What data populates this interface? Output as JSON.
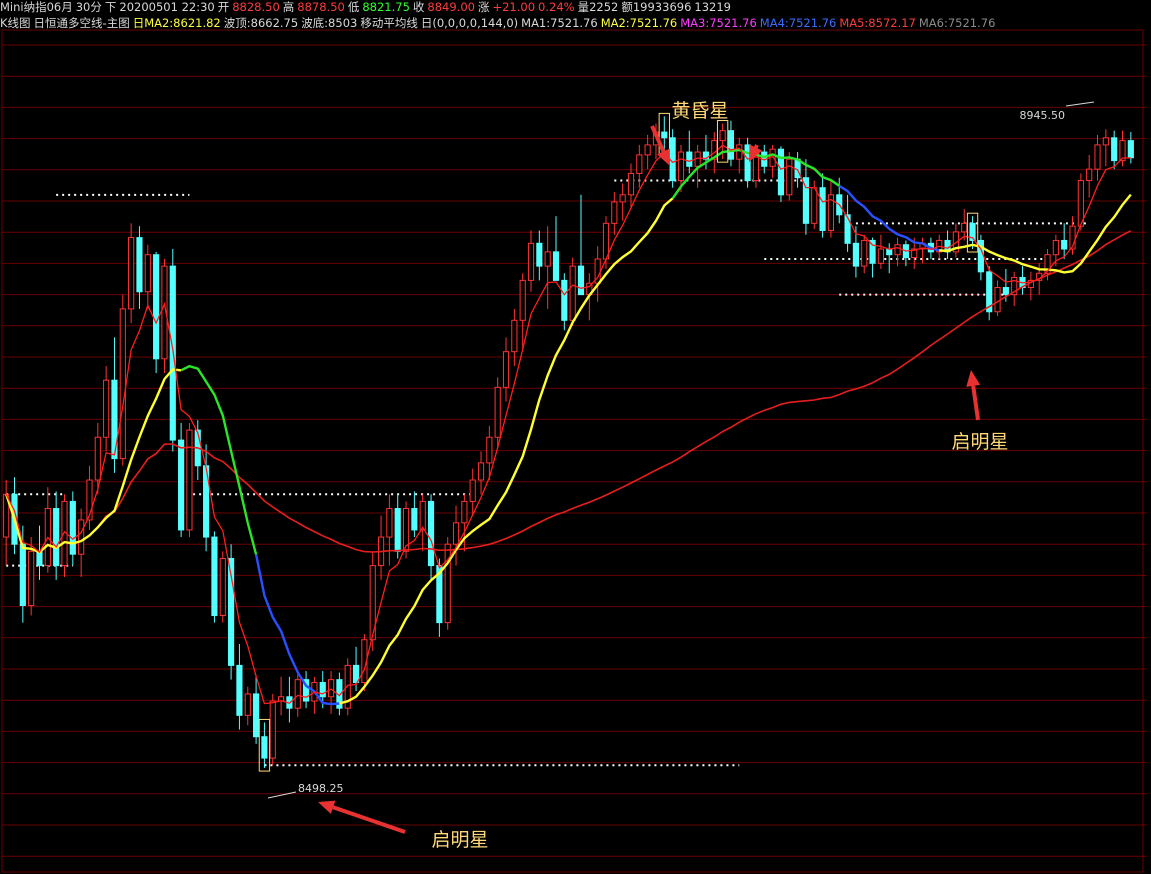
{
  "header": {
    "symbol": "Mini纳指06月",
    "period": "30分",
    "direction": "下",
    "datetime": "20200501 22:30",
    "open_label": "开",
    "open": "8828.50",
    "high_label": "高",
    "high": "8878.50",
    "low_label": "低",
    "low": "8821.75",
    "close_label": "收",
    "close": "8849.00",
    "change_label": "涨",
    "change": "+21.00",
    "change_pct": "0.24%",
    "volume": "量2252",
    "amount": "额19933696",
    "extra": "13219"
  },
  "indicator_bar": {
    "main_label": "K线图",
    "ind1": "日恒通多空线-主图",
    "ind1_ma2": "日MA2:8621.82",
    "ind1_top": "波顶:8662.75",
    "ind1_bottom": "波底:8503",
    "ind2": "移动平均线",
    "ind2_params": "日(0,0,0,0,144,0)",
    "ma1": "MA1:7521.76",
    "ma2": "MA2:7521.76",
    "ma3": "MA3:7521.76",
    "ma4": "MA4:7521.76",
    "ma5": "MA5:8572.17",
    "ma6": "MA6:7521.76"
  },
  "colors": {
    "background": "#000000",
    "grid": "#6a0000",
    "up_candle": "#ff3232",
    "down_candle": "#54ffff",
    "ma_short": "#ff1e1e",
    "ma_bull": "#ffff32",
    "ma_bear_green": "#28e628",
    "ma_bear_blue": "#2850ff",
    "ma_long": "#e81e1e",
    "level_dots": "#ffffff",
    "annotation_text": "#ffd878",
    "annotation_arrow": "#e83232",
    "pattern_box": "#ffd878"
  },
  "chart_data": {
    "type": "candlestick",
    "annotations": [
      {
        "text": "黄昏星"
      },
      {
        "text": "启明星"
      },
      {
        "text": "启明星"
      }
    ],
    "price_labels": [
      "8945.50",
      "8498.25"
    ],
    "candles": [
      [
        8660,
        8700,
        8640,
        8690
      ],
      [
        8690,
        8702,
        8648,
        8655
      ],
      [
        8655,
        8668,
        8600,
        8612
      ],
      [
        8612,
        8660,
        8605,
        8650
      ],
      [
        8650,
        8668,
        8630,
        8640
      ],
      [
        8640,
        8695,
        8635,
        8680
      ],
      [
        8680,
        8692,
        8630,
        8640
      ],
      [
        8640,
        8690,
        8632,
        8685
      ],
      [
        8685,
        8692,
        8640,
        8648
      ],
      [
        8648,
        8680,
        8632,
        8672
      ],
      [
        8672,
        8710,
        8665,
        8700
      ],
      [
        8700,
        8740,
        8690,
        8730
      ],
      [
        8730,
        8780,
        8720,
        8770
      ],
      [
        8770,
        8800,
        8705,
        8715
      ],
      [
        8715,
        8830,
        8710,
        8820
      ],
      [
        8820,
        8880,
        8810,
        8870
      ],
      [
        8870,
        8878,
        8820,
        8832
      ],
      [
        8832,
        8865,
        8820,
        8858
      ],
      [
        8858,
        8860,
        8775,
        8785
      ],
      [
        8785,
        8855,
        8775,
        8850
      ],
      [
        8850,
        8862,
        8720,
        8728
      ],
      [
        8728,
        8740,
        8660,
        8665
      ],
      [
        8665,
        8740,
        8660,
        8735
      ],
      [
        8735,
        8742,
        8700,
        8710
      ],
      [
        8710,
        8725,
        8650,
        8660
      ],
      [
        8660,
        8664,
        8600,
        8605
      ],
      [
        8605,
        8650,
        8600,
        8645
      ],
      [
        8645,
        8655,
        8560,
        8570
      ],
      [
        8570,
        8585,
        8525,
        8535
      ],
      [
        8535,
        8555,
        8528,
        8550
      ],
      [
        8550,
        8562,
        8515,
        8520
      ],
      [
        8520,
        8530,
        8498,
        8505
      ],
      [
        8505,
        8550,
        8500,
        8545
      ],
      [
        8545,
        8562,
        8535,
        8548
      ],
      [
        8548,
        8562,
        8530,
        8540
      ],
      [
        8540,
        8565,
        8534,
        8560
      ],
      [
        8560,
        8566,
        8540,
        8545
      ],
      [
        8545,
        8562,
        8536,
        8558
      ],
      [
        8558,
        8566,
        8540,
        8548
      ],
      [
        8548,
        8566,
        8536,
        8560
      ],
      [
        8560,
        8565,
        8535,
        8540
      ],
      [
        8540,
        8575,
        8535,
        8570
      ],
      [
        8570,
        8583,
        8552,
        8558
      ],
      [
        8558,
        8592,
        8552,
        8588
      ],
      [
        8588,
        8650,
        8580,
        8640
      ],
      [
        8640,
        8675,
        8630,
        8660
      ],
      [
        8660,
        8690,
        8640,
        8680
      ],
      [
        8680,
        8690,
        8645,
        8650
      ],
      [
        8650,
        8685,
        8645,
        8680
      ],
      [
        8680,
        8692,
        8660,
        8665
      ],
      [
        8665,
        8690,
        8650,
        8685
      ],
      [
        8685,
        8690,
        8630,
        8640
      ],
      [
        8640,
        8645,
        8590,
        8600
      ],
      [
        8600,
        8660,
        8595,
        8655
      ],
      [
        8655,
        8682,
        8640,
        8670
      ],
      [
        8670,
        8690,
        8650,
        8685
      ],
      [
        8685,
        8708,
        8675,
        8700
      ],
      [
        8700,
        8720,
        8690,
        8712
      ],
      [
        8712,
        8738,
        8700,
        8730
      ],
      [
        8730,
        8772,
        8722,
        8765
      ],
      [
        8765,
        8800,
        8755,
        8790
      ],
      [
        8790,
        8820,
        8780,
        8812
      ],
      [
        8812,
        8845,
        8790,
        8840
      ],
      [
        8840,
        8875,
        8832,
        8866
      ],
      [
        8866,
        8875,
        8840,
        8850
      ],
      [
        8850,
        8878,
        8820,
        8860
      ],
      [
        8860,
        8885,
        8846,
        8840
      ],
      [
        8840,
        8845,
        8805,
        8812
      ],
      [
        8812,
        8856,
        8808,
        8850
      ],
      [
        8850,
        8900,
        8838,
        8830
      ],
      [
        8830,
        8845,
        8812,
        8838
      ],
      [
        8838,
        8864,
        8825,
        8855
      ],
      [
        8855,
        8885,
        8848,
        8880
      ],
      [
        8880,
        8902,
        8872,
        8895
      ],
      [
        8895,
        8908,
        8882,
        8900
      ],
      [
        8900,
        8922,
        8890,
        8915
      ],
      [
        8915,
        8935,
        8905,
        8928
      ],
      [
        8928,
        8942,
        8918,
        8935
      ],
      [
        8935,
        8950,
        8925,
        8944
      ],
      [
        8944,
        8955,
        8930,
        8940
      ],
      [
        8940,
        8946,
        8905,
        8910
      ],
      [
        8910,
        8935,
        8902,
        8930
      ],
      [
        8930,
        8945,
        8915,
        8920
      ],
      [
        8920,
        8935,
        8905,
        8930
      ],
      [
        8930,
        8942,
        8918,
        8925
      ],
      [
        8925,
        8944,
        8915,
        8938
      ],
      [
        8938,
        8950,
        8925,
        8945
      ],
      [
        8945,
        8952,
        8920,
        8925
      ],
      [
        8925,
        8940,
        8915,
        8935
      ],
      [
        8935,
        8940,
        8905,
        8910
      ],
      [
        8910,
        8935,
        8905,
        8930
      ],
      [
        8930,
        8935,
        8915,
        8920
      ],
      [
        8920,
        8935,
        8912,
        8932
      ],
      [
        8932,
        8934,
        8895,
        8900
      ],
      [
        8900,
        8930,
        8896,
        8925
      ],
      [
        8925,
        8930,
        8905,
        8912
      ],
      [
        8912,
        8925,
        8872,
        8880
      ],
      [
        8880,
        8910,
        8876,
        8905
      ],
      [
        8905,
        8915,
        8870,
        8875
      ],
      [
        8875,
        8910,
        8870,
        8900
      ],
      [
        8900,
        8912,
        8880,
        8886
      ],
      [
        8886,
        8900,
        8860,
        8866
      ],
      [
        8866,
        8878,
        8842,
        8850
      ],
      [
        8850,
        8872,
        8845,
        8868
      ],
      [
        8868,
        8870,
        8842,
        8852
      ],
      [
        8852,
        8872,
        8848,
        8862
      ],
      [
        8862,
        8866,
        8845,
        8858
      ],
      [
        8858,
        8870,
        8850,
        8865
      ],
      [
        8865,
        8868,
        8850,
        8856
      ],
      [
        8856,
        8870,
        8848,
        8862
      ],
      [
        8862,
        8870,
        8852,
        8866
      ],
      [
        8866,
        8870,
        8855,
        8860
      ],
      [
        8860,
        8872,
        8855,
        8868
      ],
      [
        8868,
        8875,
        8855,
        8860
      ],
      [
        8860,
        8880,
        8856,
        8874
      ],
      [
        8874,
        8890,
        8868,
        8880
      ],
      [
        8880,
        8885,
        8862,
        8868
      ],
      [
        8868,
        8872,
        8840,
        8846
      ],
      [
        8846,
        8850,
        8812,
        8818
      ],
      [
        8818,
        8840,
        8815,
        8835
      ],
      [
        8835,
        8848,
        8825,
        8830
      ],
      [
        8830,
        8846,
        8822,
        8842
      ],
      [
        8842,
        8850,
        8830,
        8835
      ],
      [
        8835,
        8846,
        8826,
        8840
      ],
      [
        8840,
        8852,
        8830,
        8845
      ],
      [
        8845,
        8862,
        8840,
        8858
      ],
      [
        8858,
        8872,
        8850,
        8868
      ],
      [
        8868,
        8880,
        8855,
        8862
      ],
      [
        8862,
        8885,
        8858,
        8878
      ],
      [
        8878,
        8915,
        8875,
        8910
      ],
      [
        8910,
        8928,
        8898,
        8918
      ],
      [
        8918,
        8942,
        8910,
        8935
      ],
      [
        8935,
        8946,
        8920,
        8940
      ],
      [
        8940,
        8945,
        8918,
        8924
      ],
      [
        8924,
        8945,
        8920,
        8938
      ],
      [
        8938,
        8944,
        8922,
        8926
      ]
    ]
  }
}
